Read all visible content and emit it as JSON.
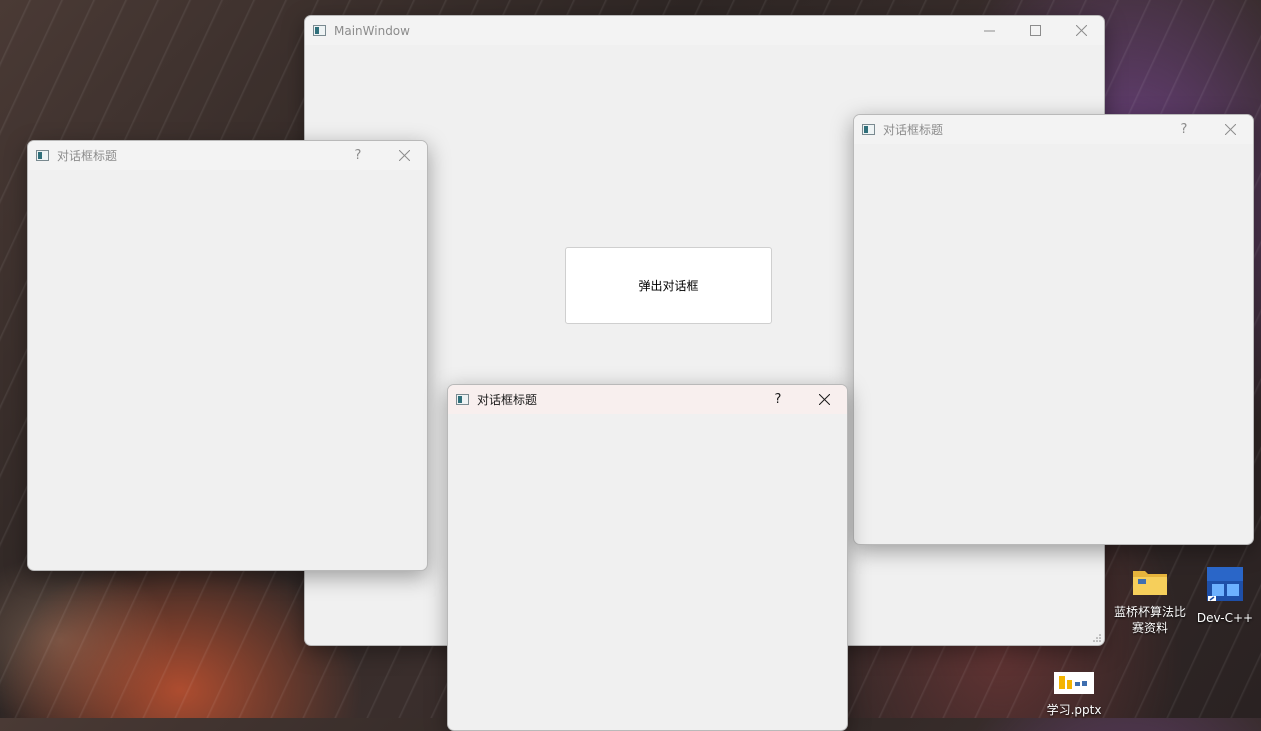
{
  "main_window": {
    "title": "MainWindow",
    "button_label": "弹出对话框"
  },
  "dialogs": [
    {
      "title": "对话框标题",
      "help": "?",
      "state": "inactive"
    },
    {
      "title": "对话框标题",
      "help": "?",
      "state": "inactive"
    },
    {
      "title": "对话框标题",
      "help": "?",
      "state": "active"
    }
  ],
  "desktop_icons": [
    {
      "label": "蓝桥杯算法比赛资料",
      "icon": "folder-icon"
    },
    {
      "label": "Dev-C++",
      "icon": "dev-cpp-icon",
      "badge": "DEV"
    },
    {
      "label": "学习.pptx",
      "icon": "pptx-file-icon"
    }
  ],
  "colors": {
    "window_bg": "#f0f0f0",
    "active_titlebar": "#f8efee",
    "inactive_title_text": "#8c8c8c"
  }
}
